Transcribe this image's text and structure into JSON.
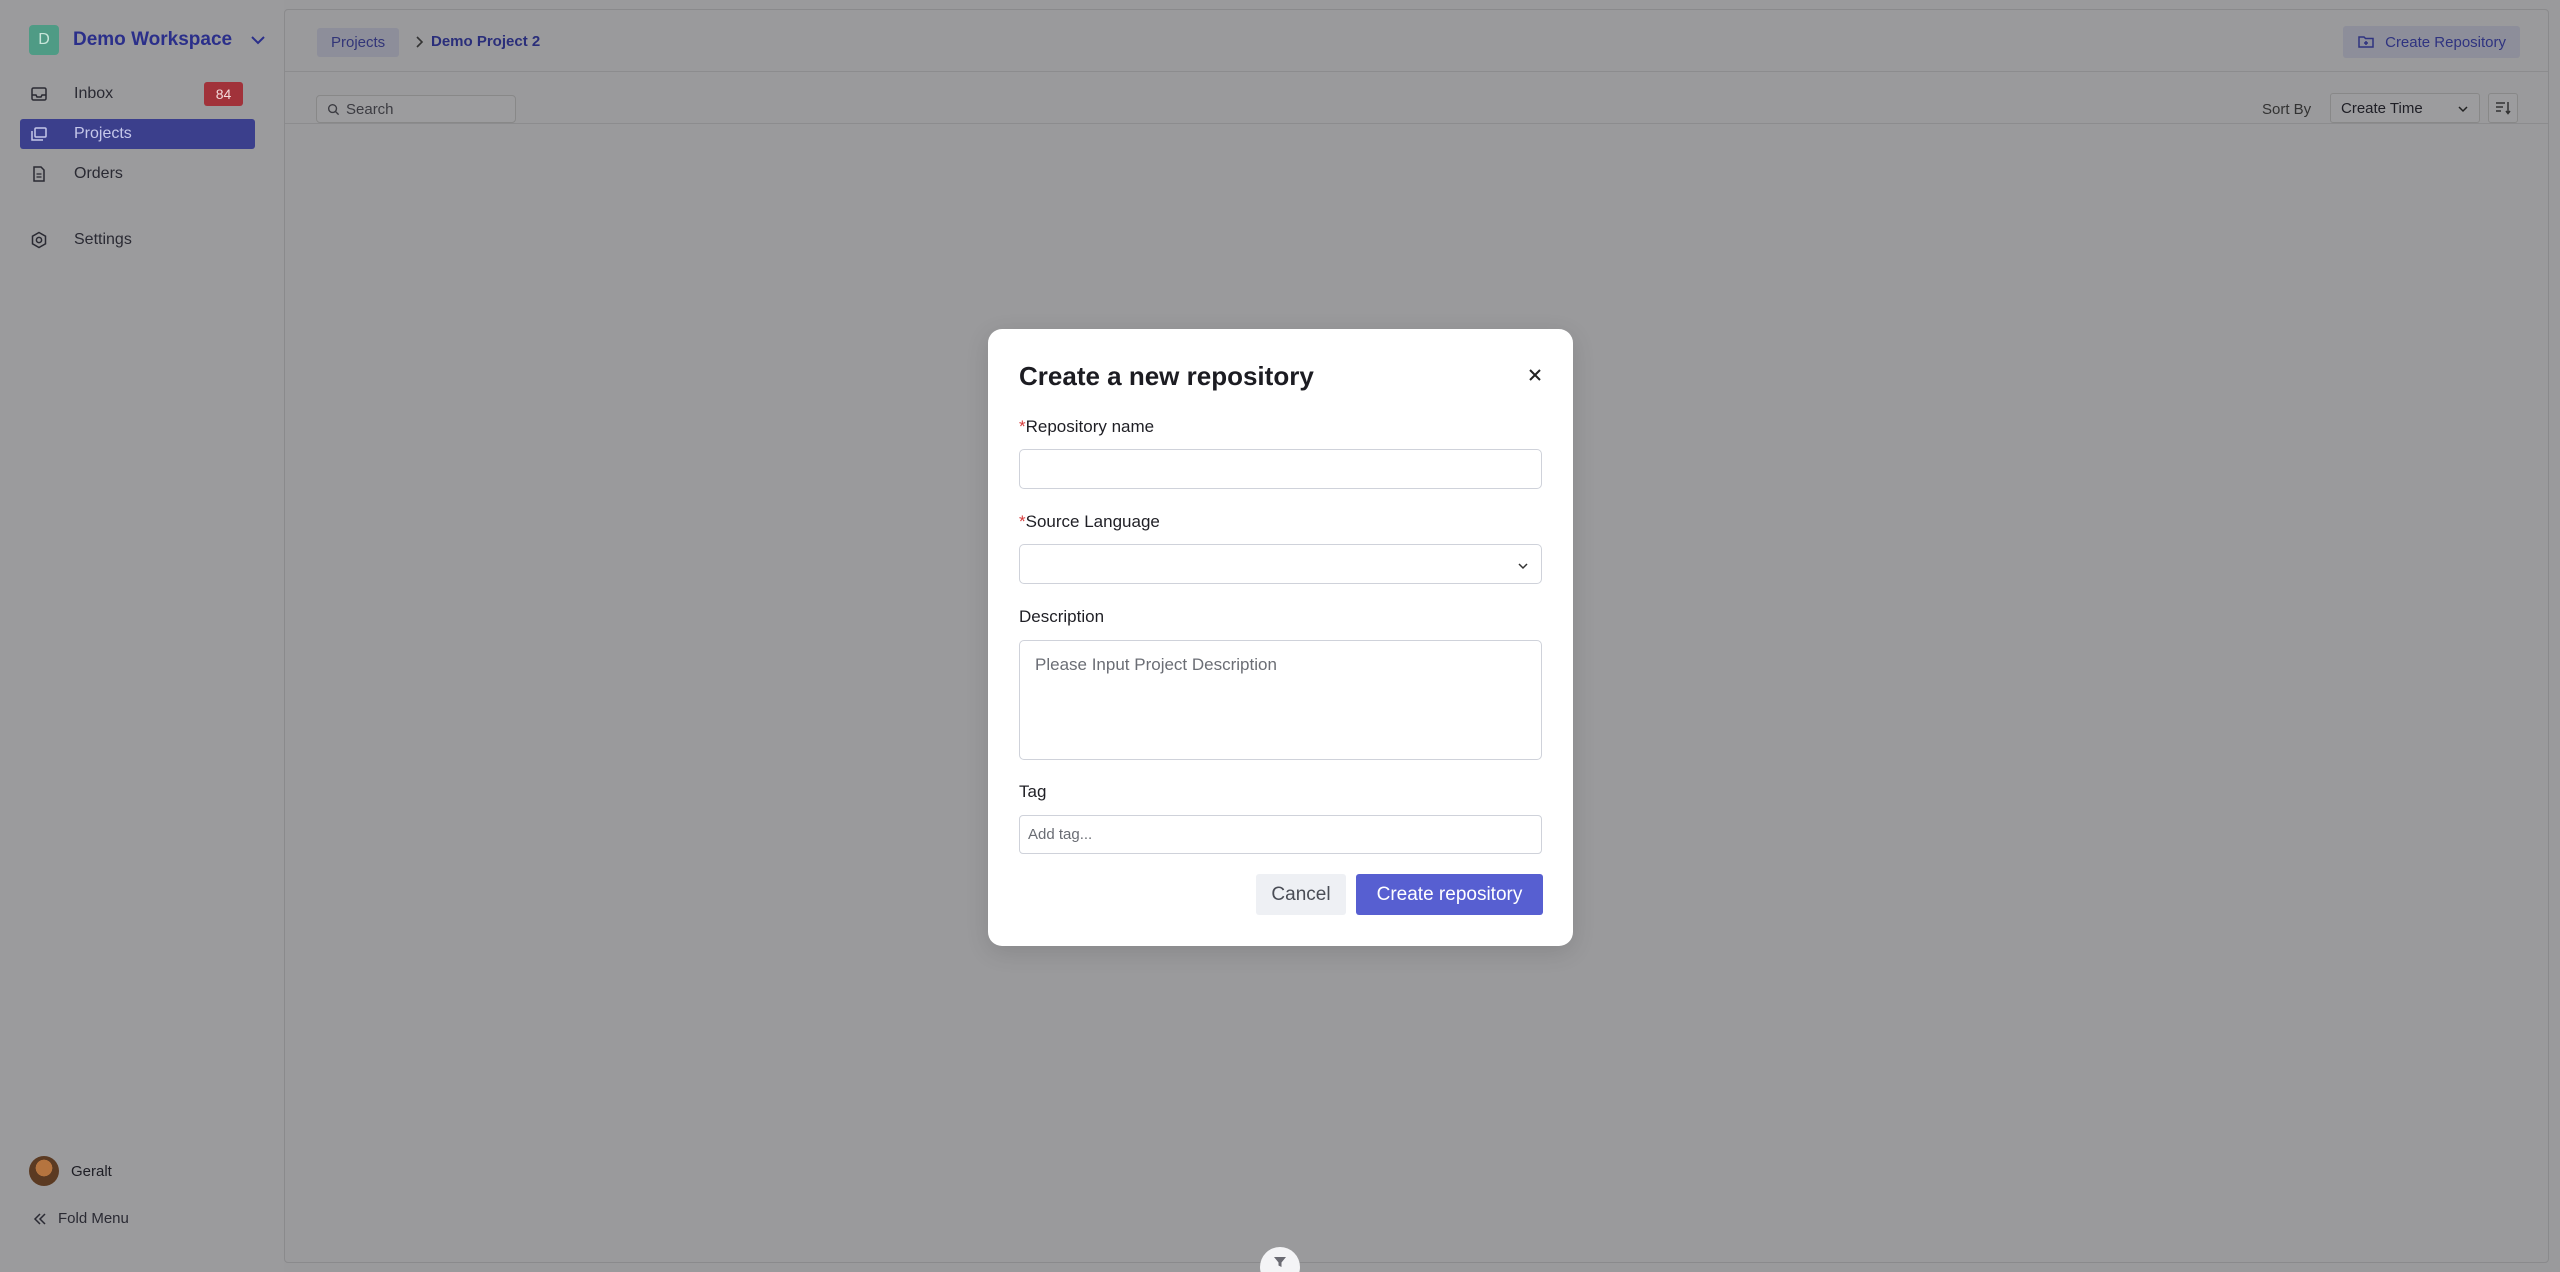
{
  "workspace": {
    "initial": "D",
    "name": "Demo Workspace"
  },
  "sidebar": {
    "items": [
      {
        "label": "Inbox",
        "badge": "84",
        "icon": "inbox-icon"
      },
      {
        "label": "Projects",
        "icon": "projects-icon"
      },
      {
        "label": "Orders",
        "icon": "document-icon"
      },
      {
        "label": "Settings",
        "icon": "gear-icon"
      }
    ],
    "user": "Geralt",
    "fold_label": "Fold Menu"
  },
  "breadcrumb": {
    "root": "Projects",
    "current": "Demo Project 2"
  },
  "header": {
    "create_repo_label": "Create Repository"
  },
  "toolbar": {
    "search_placeholder": "Search",
    "sort_by_label": "Sort By",
    "sort_value": "Create Time"
  },
  "modal": {
    "title": "Create a new repository",
    "repo_name_label": "Repository name",
    "source_language_label": "Source Language",
    "description_label": "Description",
    "description_placeholder": "Please Input Project Description",
    "tag_label": "Tag",
    "tag_placeholder": "Add tag...",
    "required_mark": "*",
    "cancel_label": "Cancel",
    "create_label": "Create repository"
  },
  "colors": {
    "accent": "#575fd1",
    "badge": "#a1323a",
    "overlay": "#9a9a9c"
  }
}
